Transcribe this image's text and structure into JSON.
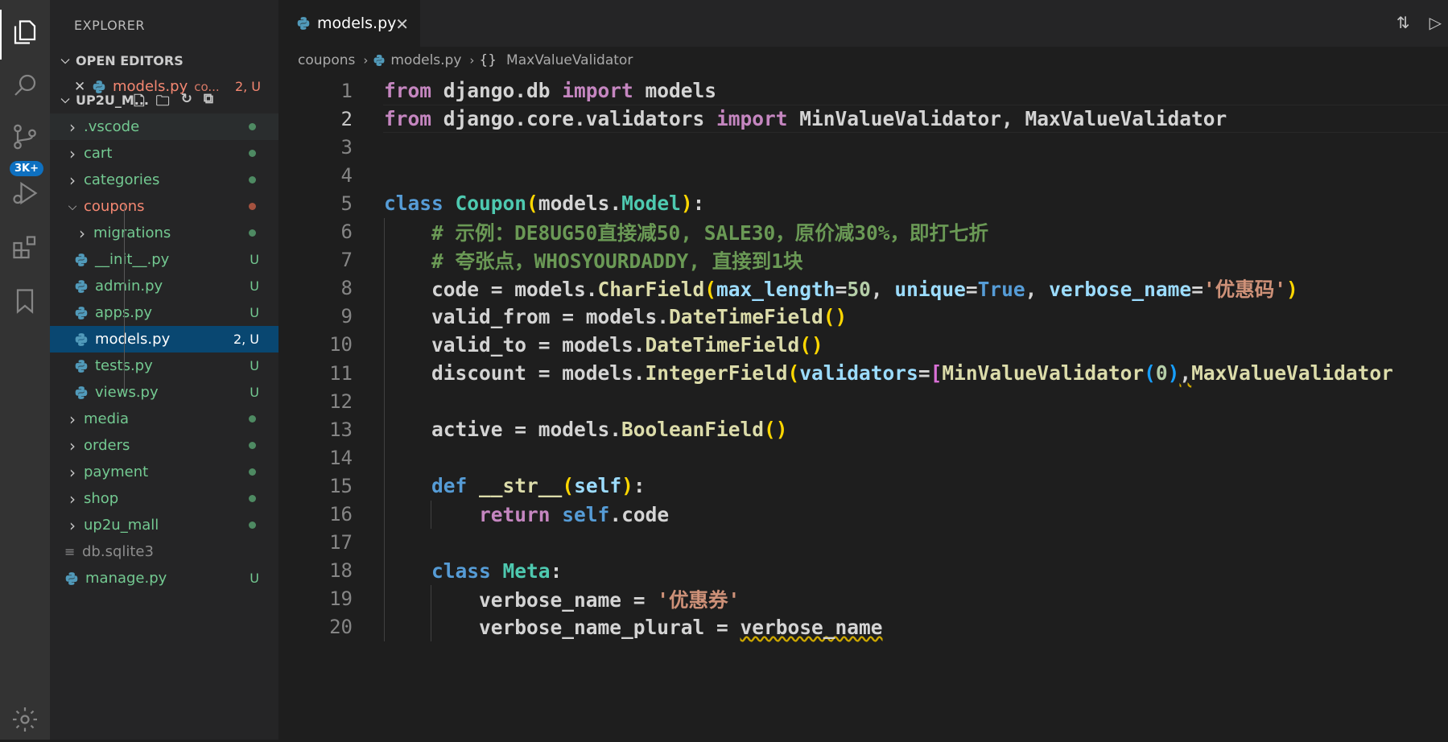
{
  "activity_bar": {
    "items": [
      "explorer-icon",
      "search-icon",
      "source-control-icon",
      "run-debug-icon",
      "extensions-icon",
      "bookmarks-icon"
    ],
    "scm_badge": "3K+",
    "bottom": "settings-gear-icon"
  },
  "sidebar": {
    "title": "EXPLORER",
    "open_editors_label": "OPEN EDITORS",
    "open_editor": {
      "name": "models.py",
      "folder": "co...",
      "status": "2, U"
    },
    "workspace_label": "UP2U_M...",
    "tree": [
      {
        "name": ".vscode",
        "type": "folder",
        "state": "collapsed",
        "color": "#73c991",
        "marker": "dot"
      },
      {
        "name": "cart",
        "type": "folder",
        "state": "collapsed",
        "color": "#73c991",
        "marker": "dot"
      },
      {
        "name": "categories",
        "type": "folder",
        "state": "collapsed",
        "color": "#73c991",
        "marker": "dot"
      },
      {
        "name": "coupons",
        "type": "folder",
        "state": "expanded",
        "color": "#f48771",
        "marker": "dot-red"
      },
      {
        "name": "migrations",
        "type": "folder",
        "state": "collapsed",
        "color": "#73c991",
        "marker": "dot",
        "indent": 1
      },
      {
        "name": "__init__.py",
        "type": "py",
        "color": "#73c991",
        "status": "U",
        "indent": 1
      },
      {
        "name": "admin.py",
        "type": "py",
        "color": "#73c991",
        "status": "U",
        "indent": 1
      },
      {
        "name": "apps.py",
        "type": "py",
        "color": "#73c991",
        "status": "U",
        "indent": 1
      },
      {
        "name": "models.py",
        "type": "py",
        "color": "#ffffff",
        "status": "2, U",
        "indent": 1,
        "selected": true
      },
      {
        "name": "tests.py",
        "type": "py",
        "color": "#73c991",
        "status": "U",
        "indent": 1
      },
      {
        "name": "views.py",
        "type": "py",
        "color": "#73c991",
        "status": "U",
        "indent": 1
      },
      {
        "name": "media",
        "type": "folder",
        "state": "collapsed",
        "color": "#73c991",
        "marker": "dot"
      },
      {
        "name": "orders",
        "type": "folder",
        "state": "collapsed",
        "color": "#73c991",
        "marker": "dot"
      },
      {
        "name": "payment",
        "type": "folder",
        "state": "collapsed",
        "color": "#73c991",
        "marker": "dot"
      },
      {
        "name": "shop",
        "type": "folder",
        "state": "collapsed",
        "color": "#73c991",
        "marker": "dot"
      },
      {
        "name": "up2u_mall",
        "type": "folder",
        "state": "collapsed",
        "color": "#73c991",
        "marker": "dot"
      },
      {
        "name": "db.sqlite3",
        "type": "file",
        "color": "#8c8c8c"
      },
      {
        "name": "manage.py",
        "type": "py",
        "color": "#73c991",
        "status": "U"
      }
    ]
  },
  "editor": {
    "tab_label": "models.py",
    "breadcrumb": {
      "folder": "coupons",
      "file": "models.py",
      "symbol_icon": "{}",
      "symbol": "MaxValueValidator"
    },
    "current_line": 2,
    "lines": [
      [
        [
          "kw",
          "from"
        ],
        [
          "t",
          " django.db "
        ],
        [
          "kw",
          "import"
        ],
        [
          "t",
          " models"
        ]
      ],
      [
        [
          "kw",
          "from"
        ],
        [
          "t",
          " django.core.validators "
        ],
        [
          "kw",
          "import"
        ],
        [
          "t",
          " MinValueValidator, MaxValueValidator"
        ]
      ],
      [],
      [],
      [
        [
          "kb",
          "class"
        ],
        [
          "t",
          " "
        ],
        [
          "cls",
          "Coupon"
        ],
        [
          "b1",
          "("
        ],
        [
          "t",
          "models."
        ],
        [
          "cls",
          "Model"
        ],
        [
          "b1",
          ")"
        ],
        [
          "t",
          ":"
        ]
      ],
      [
        [
          "t",
          "    "
        ],
        [
          "cmt",
          "# 示例：DE8UG50直接减50, SALE30，原价减30%，即打七折"
        ]
      ],
      [
        [
          "t",
          "    "
        ],
        [
          "cmt",
          "# 夸张点，WHOSYOURDADDY, 直接到1块"
        ]
      ],
      [
        [
          "t",
          "    code = models."
        ],
        [
          "fn",
          "CharField"
        ],
        [
          "b1",
          "("
        ],
        [
          "prm",
          "max_length"
        ],
        [
          "t",
          "="
        ],
        [
          "num",
          "50"
        ],
        [
          "t",
          ", "
        ],
        [
          "prm",
          "unique"
        ],
        [
          "t",
          "="
        ],
        [
          "kb",
          "True"
        ],
        [
          "t",
          ", "
        ],
        [
          "prm",
          "verbose_name"
        ],
        [
          "t",
          "="
        ],
        [
          "str",
          "'优惠码'"
        ],
        [
          "b1",
          ")"
        ]
      ],
      [
        [
          "t",
          "    valid_from = models."
        ],
        [
          "fn",
          "DateTimeField"
        ],
        [
          "b1",
          "()"
        ]
      ],
      [
        [
          "t",
          "    valid_to = models."
        ],
        [
          "fn",
          "DateTimeField"
        ],
        [
          "b1",
          "()"
        ]
      ],
      [
        [
          "t",
          "    discount = models."
        ],
        [
          "fn",
          "IntegerField"
        ],
        [
          "b1",
          "("
        ],
        [
          "prm",
          "validators"
        ],
        [
          "t",
          "="
        ],
        [
          "b2",
          "["
        ],
        [
          "fn",
          "MinValueValidator"
        ],
        [
          "b3",
          "("
        ],
        [
          "num",
          "0"
        ],
        [
          "b3",
          ")"
        ],
        [
          "sq",
          ","
        ],
        [
          "fn",
          "MaxValueValidator"
        ]
      ],
      [],
      [
        [
          "t",
          "    active = models."
        ],
        [
          "fn",
          "BooleanField"
        ],
        [
          "b1",
          "()"
        ]
      ],
      [],
      [
        [
          "t",
          "    "
        ],
        [
          "kb",
          "def"
        ],
        [
          "t",
          " "
        ],
        [
          "fn",
          "__str__"
        ],
        [
          "b1",
          "("
        ],
        [
          "prm",
          "self"
        ],
        [
          "b1",
          ")"
        ],
        [
          "t",
          ":"
        ]
      ],
      [
        [
          "t",
          "        "
        ],
        [
          "kw",
          "return"
        ],
        [
          "t",
          " "
        ],
        [
          "kb",
          "self"
        ],
        [
          "t",
          ".code"
        ]
      ],
      [],
      [
        [
          "t",
          "    "
        ],
        [
          "kb",
          "class"
        ],
        [
          "t",
          " "
        ],
        [
          "cls",
          "Meta"
        ],
        [
          "t",
          ":"
        ]
      ],
      [
        [
          "t",
          "        verbose_name = "
        ],
        [
          "str",
          "'优惠券'"
        ]
      ],
      [
        [
          "t",
          "        verbose_name_plural = "
        ],
        [
          "sq",
          "verbose_name"
        ]
      ]
    ]
  }
}
